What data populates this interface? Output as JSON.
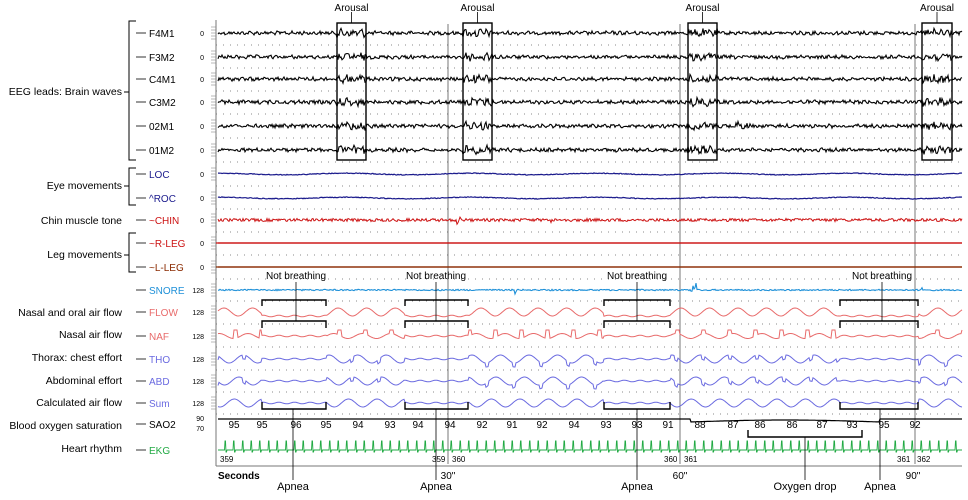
{
  "categories": [
    {
      "label": "EEG leads: Brain waves"
    },
    {
      "label": "Eye movements"
    },
    {
      "label": "Chin muscle tone"
    },
    {
      "label": "Leg movements"
    },
    {
      "label": "Nasal and oral air flow"
    },
    {
      "label": "Nasal air flow"
    },
    {
      "label": "Thorax: chest effort"
    },
    {
      "label": "Abdominal effort"
    },
    {
      "label": "Calculated air flow"
    },
    {
      "label": "Blood oxygen saturation"
    },
    {
      "label": "Heart rhythm"
    }
  ],
  "channels": [
    {
      "name": "F4M1",
      "scale": "0",
      "color": "#000000"
    },
    {
      "name": "F3M2",
      "scale": "0",
      "color": "#000000"
    },
    {
      "name": "C4M1",
      "scale": "0",
      "color": "#000000"
    },
    {
      "name": "C3M2",
      "scale": "0",
      "color": "#000000"
    },
    {
      "name": "02M1",
      "scale": "0",
      "color": "#000000"
    },
    {
      "name": "01M2",
      "scale": "0",
      "color": "#000000"
    },
    {
      "name": "LOC",
      "scale": "0",
      "color": "#1a1a8c"
    },
    {
      "name": "^ROC",
      "scale": "0",
      "color": "#1a1a8c"
    },
    {
      "name": "~CHIN",
      "scale": "0",
      "color": "#cc1111"
    },
    {
      "name": "~R-LEG",
      "scale": "0",
      "color": "#cc1111"
    },
    {
      "name": "~L-LEG",
      "scale": "0",
      "color": "#8a2a00"
    },
    {
      "name": "SNORE",
      "scale": "128",
      "color": "#1e90d8"
    },
    {
      "name": "FLOW",
      "scale": "128",
      "color": "#e86a6a"
    },
    {
      "name": "NAF",
      "scale": "128",
      "color": "#e86a6a"
    },
    {
      "name": "THO",
      "scale": "128",
      "color": "#6a6ae0"
    },
    {
      "name": "ABD",
      "scale": "128",
      "color": "#6a6ae0"
    },
    {
      "name": "Sum",
      "scale": "128",
      "color": "#6a6ae0"
    },
    {
      "name": "SAO2",
      "scale_top": "90",
      "scale_bottom": "70",
      "color": "#000000"
    },
    {
      "name": "EKG",
      "scale": "",
      "color": "#22aa44"
    }
  ],
  "annotations": {
    "arousal": [
      "Arousal",
      "Arousal",
      "Arousal",
      "Arousal"
    ],
    "not_breathing": [
      "Not breathing",
      "Not breathing",
      "Not breathing",
      "Not breathing"
    ],
    "apnea": [
      "Apnea",
      "Apnea",
      "Apnea",
      "Apnea"
    ],
    "oxygen_drop": "Oxygen drop"
  },
  "sao2_values": [
    "95",
    "95",
    "96",
    "95",
    "94",
    "93",
    "94",
    "94",
    "92",
    "91",
    "92",
    "94",
    "93",
    "93",
    "91",
    "88",
    "87",
    "86",
    "86",
    "87",
    "93",
    "95",
    "92"
  ],
  "time_axis": {
    "unit_label": "Seconds",
    "marks": [
      "30\"",
      "60\"",
      "90\""
    ],
    "epochs": [
      "359",
      "359",
      "360",
      "360",
      "361",
      "361",
      "362"
    ]
  }
}
